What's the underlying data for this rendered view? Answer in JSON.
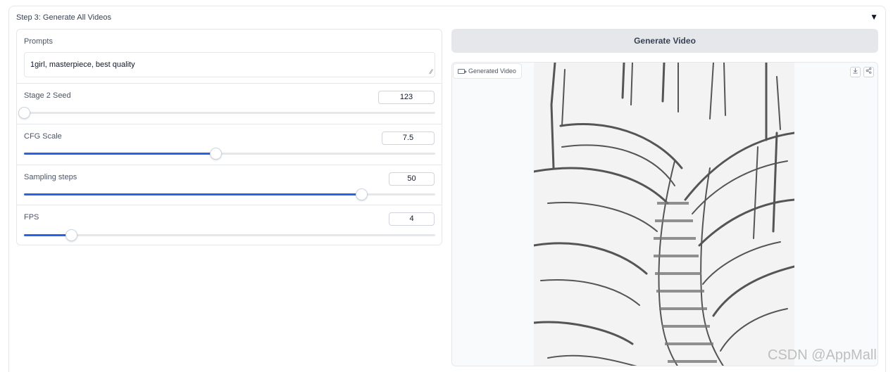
{
  "accordion": {
    "title": "Step 3: Generate All Videos",
    "toggle_icon": "▼"
  },
  "prompts": {
    "label": "Prompts",
    "value": "1girl, masterpiece, best quality"
  },
  "sliders": [
    {
      "label": "Stage 2 Seed",
      "value": "123",
      "fill_fraction": 0.0
    },
    {
      "label": "CFG Scale",
      "value": "7.5",
      "fill_fraction": 0.465
    },
    {
      "label": "Sampling steps",
      "value": "50",
      "fill_fraction": 0.82
    },
    {
      "label": "FPS",
      "value": "4",
      "fill_fraction": 0.115
    }
  ],
  "generate_button": {
    "label": "Generate Video"
  },
  "video": {
    "label": "Generated Video",
    "download_icon": "download-icon",
    "share_icon": "share-icon"
  },
  "watermark": "CSDN @AppMall",
  "colors": {
    "accent": "#2563eb",
    "border": "#e5e7eb",
    "button_bg": "#e5e7eb"
  }
}
